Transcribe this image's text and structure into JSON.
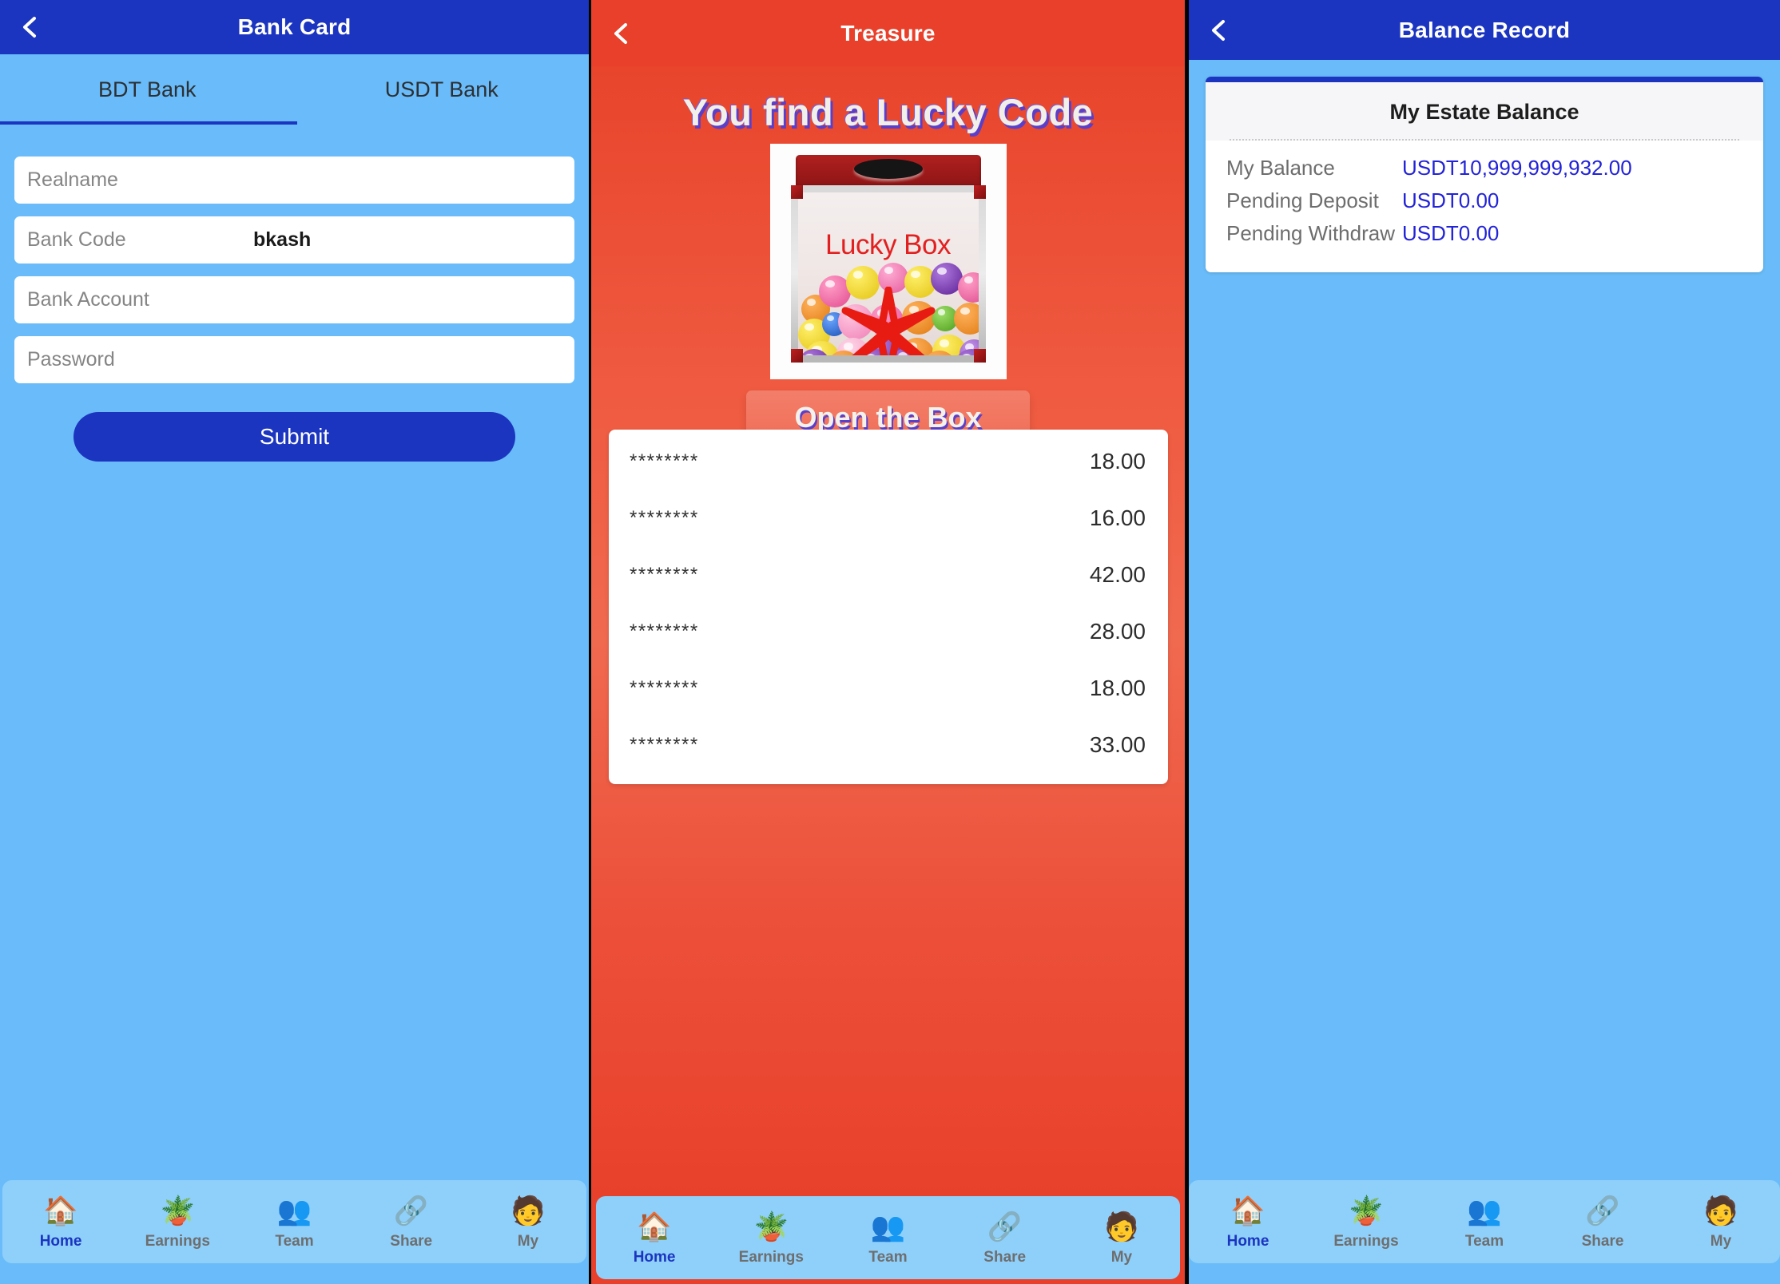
{
  "bank_panel": {
    "header": {
      "title": "Bank Card",
      "back_icon": "chevron-left-icon"
    },
    "tabs": [
      {
        "label": "BDT Bank",
        "active": true
      },
      {
        "label": "USDT Bank",
        "active": false
      }
    ],
    "fields": [
      {
        "name": "realname",
        "placeholder": "Realname",
        "value": ""
      },
      {
        "name": "bank-code",
        "placeholder": "Bank Code",
        "value": "bkash"
      },
      {
        "name": "bank-account",
        "placeholder": "Bank Account",
        "value": ""
      },
      {
        "name": "password",
        "placeholder": "Password",
        "value": ""
      }
    ],
    "submit_label": "Submit",
    "colors": {
      "header": "#1b35c0",
      "background": "#69bcf9",
      "button": "#1b35c0"
    }
  },
  "treasure_panel": {
    "header": {
      "title": "Treasure",
      "back_icon": "chevron-left-icon"
    },
    "heading": "You find a Lucky Code",
    "box_image_label": "Lucky Box",
    "open_button_label": "Open the Box",
    "code_rows": [
      {
        "code": "********",
        "amount": "18.00"
      },
      {
        "code": "********",
        "amount": "16.00"
      },
      {
        "code": "********",
        "amount": "42.00"
      },
      {
        "code": "********",
        "amount": "28.00"
      },
      {
        "code": "********",
        "amount": "18.00"
      },
      {
        "code": "********",
        "amount": "33.00"
      }
    ],
    "colors": {
      "header": "#e8402a",
      "background": "#ef5a40",
      "accent": "#5b3fc8"
    }
  },
  "balance_panel": {
    "header": {
      "title": "Balance Record",
      "back_icon": "chevron-left-icon"
    },
    "card_title": "My Estate Balance",
    "rows": [
      {
        "label": "My Balance",
        "value": "USDT10,999,999,932.00"
      },
      {
        "label": "Pending Deposit",
        "value": "USDT0.00"
      },
      {
        "label": "Pending Withdraw",
        "value": "USDT0.00"
      }
    ],
    "colors": {
      "header": "#1b35c0",
      "background": "#69bcf9",
      "value": "#2323d8"
    }
  },
  "bottom_nav": {
    "items": [
      {
        "label": "Home",
        "icon": "house-icon",
        "glyph": "🏠",
        "active": true
      },
      {
        "label": "Earnings",
        "icon": "money-plant-icon",
        "glyph": "🪴",
        "active": false
      },
      {
        "label": "Team",
        "icon": "people-group-icon",
        "glyph": "👥",
        "active": false
      },
      {
        "label": "Share",
        "icon": "share-node-icon",
        "glyph": "🔗",
        "active": false
      },
      {
        "label": "My",
        "icon": "user-avatar-icon",
        "glyph": "🧑",
        "active": false
      }
    ]
  }
}
